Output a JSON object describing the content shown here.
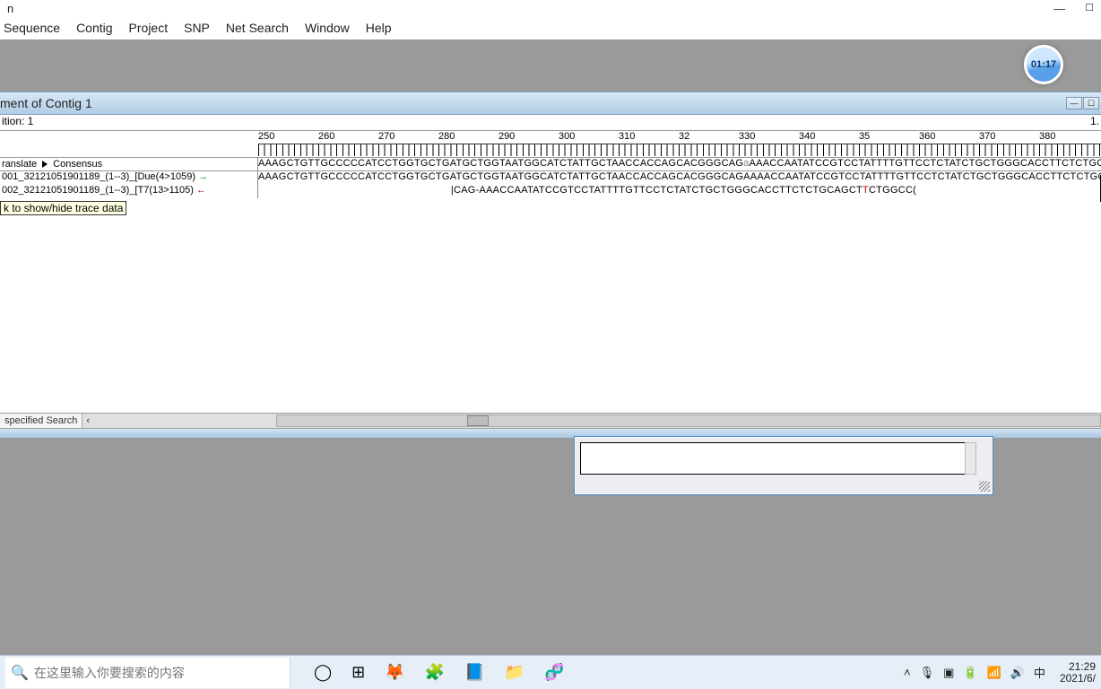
{
  "window": {
    "title_fragment": "n"
  },
  "menubar": {
    "items": [
      "Sequence",
      "Contig",
      "Project",
      "SNP",
      "Net Search",
      "Window",
      "Help"
    ]
  },
  "clock_badge": "01:17",
  "subwindow": {
    "title": "ment of Contig 1",
    "position_left": "ition: 1",
    "position_right": "1."
  },
  "ruler": {
    "labels": [
      "250",
      "260",
      "270",
      "280",
      "290",
      "300",
      "310",
      "32",
      "330",
      "340",
      "35",
      "360",
      "370",
      "380"
    ]
  },
  "tracks": {
    "consensus_label_left": "ranslate",
    "consensus_label_right": "Consensus",
    "consensus_seq": "AAAGCTGTTGCCCCCATCCTGGTGCTGATGCTGGTAATGGCATCTATTGCTAACCACCAGCACGGGCAGaAAACCAATATCCGTCCTATTTTGTTCCTCTATCTGCTGGGCACCTTCTCTGCAGCT-CTGGCC(",
    "read1_label": "001_32121051901189_(1--3)_[Due(4>1059)",
    "read1_seq": "AAAGCTGTTGCCCCCATCCTGGTGCTGATGCTGGTAATGGCATCTATTGCTAACCACCAGCACGGGCAGAAAACCAATATCCGTCCTATTTTGTTCCTCTATCTGCTGGGCACCTTCTCTGCAGCT-CTGGCC(",
    "read2_label": "002_32121051901189_(1--3)_[T7(13>1105)",
    "read2_seq_prefix_pad": "                                                                 ",
    "read2_seq": "CAG-AAACCAATATCCGTCCTATTTTGTTCCTCTATCTGCTGGGCACCTTCTCTGCAGCTTCTGGCC("
  },
  "tooltip": "k to show/hide trace data",
  "search_tab": "specified Search",
  "taskbar": {
    "search_placeholder": "在这里输入你要搜索的内容",
    "ime": "中",
    "time": "21:29",
    "date": "2021/6/"
  }
}
